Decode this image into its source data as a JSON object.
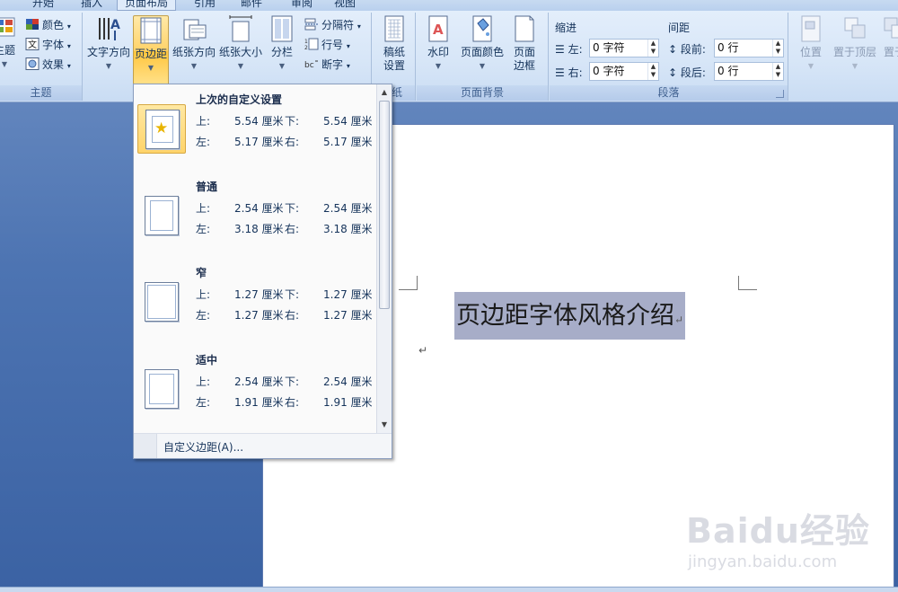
{
  "tabs": [
    "开始",
    "插入",
    "页面布局",
    "引用",
    "邮件",
    "审阅",
    "视图"
  ],
  "active_tab": "页面布局",
  "groups": {
    "theme": {
      "label": "主题",
      "theme_btn": "主题",
      "colors": "颜色",
      "fonts": "字体",
      "effects": "效果"
    },
    "page_setup": {
      "text_direction": "文字方向",
      "margins": "页边距",
      "orientation": "纸张方向",
      "size": "纸张大小",
      "columns": "分栏",
      "breaks": "分隔符",
      "line_numbers": "行号",
      "hyphenation": "断字"
    },
    "manuscript": {
      "label_partial": "纸",
      "btn_line1": "稿纸",
      "btn_line2": "设置"
    },
    "page_background": {
      "label": "页面背景",
      "watermark": "水印",
      "page_color": "页面颜色",
      "borders_line1": "页面",
      "borders_line2": "边框"
    },
    "paragraph": {
      "label": "段落",
      "indent": "缩进",
      "spacing": "间距",
      "left_label": "左:",
      "left_value": "0 字符",
      "right_label": "右:",
      "right_value": "0 字符",
      "before_label": "段前:",
      "before_value": "0 行",
      "after_label": "段后:",
      "after_value": "0 行"
    },
    "arrange": {
      "position": "位置",
      "bring_front": "置于顶层",
      "send_back": "置于"
    }
  },
  "dropdown": {
    "presets": [
      {
        "name": "上次的自定义设置",
        "top": "5.54 厘米",
        "bottom": "5.54 厘米",
        "left": "5.17 厘米",
        "right": "5.17 厘米"
      },
      {
        "name": "普通",
        "top": "2.54 厘米",
        "bottom": "2.54 厘米",
        "left": "3.18 厘米",
        "right": "3.18 厘米"
      },
      {
        "name": "窄",
        "top": "1.27 厘米",
        "bottom": "1.27 厘米",
        "left": "1.27 厘米",
        "right": "1.27 厘米"
      },
      {
        "name": "适中",
        "top": "2.54 厘米",
        "bottom": "2.54 厘米",
        "left": "1.91 厘米",
        "right": "1.91 厘米"
      }
    ],
    "labels": {
      "top": "上:",
      "bottom": "下:",
      "left": "左:",
      "right": "右:"
    },
    "custom": "自定义边距(A)..."
  },
  "document": {
    "text": "页边距字体风格介绍",
    "paragraph_mark": "↵"
  },
  "watermark": {
    "brand": "Baidu经验",
    "url": "jingyan.baidu.com"
  },
  "colors": {
    "highlight": "#ffd46a",
    "selection": "#a7adc8",
    "background": "#4d74b2"
  }
}
